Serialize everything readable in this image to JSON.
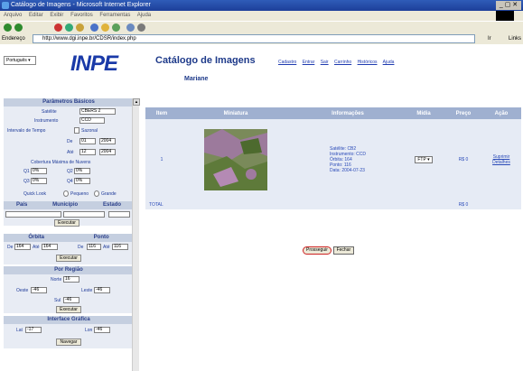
{
  "window": {
    "title": "Catálogo de Imagens - Microsoft Internet Explorer",
    "controls": "_ ▢ ✕"
  },
  "menu": [
    "Arquivo",
    "Editar",
    "Exibir",
    "Favoritos",
    "Ferramentas",
    "Ajuda"
  ],
  "address": {
    "label": "Endereço",
    "url": "http://www.dgi.inpe.br/CDSR/index.php",
    "go": "Ir",
    "links": "Links"
  },
  "colors": {
    "panel_head": "#c5cfe0",
    "table_head": "#9fb0d0",
    "brand": "#1a3aa8"
  },
  "language": {
    "value": "Português"
  },
  "brand": {
    "logo": "INPE"
  },
  "page": {
    "title": "Catálogo de Imagens",
    "user": "Mariane"
  },
  "nav": [
    "Cadastro",
    "Entrar",
    "Sair",
    "Carrinho",
    "Históricos",
    "Ajuda"
  ],
  "search": {
    "basic": {
      "header": "Parâmetros Básicos",
      "satellite_label": "Satélite",
      "satellite_value": "CBERS 2",
      "instrument_label": "Instrumento",
      "instrument_value": "CCD",
      "interval_label": "Intervalo de Tempo",
      "interval_option": "Sazonal",
      "from_label": "De",
      "from_month": "01",
      "from_year": "2004",
      "to_label": "Até",
      "to_month": "12",
      "to_year": "2004",
      "cloud_label": "Cobertura Máxima de Nuvens",
      "q1": "Q1",
      "q2": "Q2",
      "q3": "Q3",
      "q4": "Q4",
      "cloud_value": "0%",
      "quicklook_label": "Quick Look",
      "small_option": "Pequeno",
      "large_option": "Grande"
    },
    "place": {
      "country": "País",
      "city": "Município",
      "state": "Estado",
      "run": "Executar"
    },
    "orbit": {
      "header_orbit": "Órbita",
      "header_point": "Ponto",
      "from": "De",
      "to": "Até",
      "orbit_from": "164",
      "orbit_to": "164",
      "point_from": "116",
      "point_to": "116",
      "run": "Executar"
    },
    "region": {
      "header": "Por Região",
      "north": "Norte",
      "north_value": "16",
      "west": "Oeste",
      "west_value": "-46",
      "east": "Leste",
      "east_value": "-46",
      "south": "Sul",
      "south_value": "-46",
      "run": "Executar"
    },
    "graphic": {
      "header": "Interface Gráfica",
      "lat": "Lat",
      "lat_value": "-17",
      "lon": "Lon",
      "lon_value": "-46",
      "run": "Navegar"
    }
  },
  "table": {
    "headers": [
      "Item",
      "Miniatura",
      "Informações",
      "Mídia",
      "Preço",
      "Ação"
    ],
    "rows": [
      {
        "item": "1",
        "info": {
          "satellite": "Satélite: CB2",
          "instrument": "Instrumento: CCD",
          "orbit": "Órbita: 164",
          "point": "Ponto: 116",
          "date": "Data: 2004-07-23"
        },
        "media": "FTP",
        "price": "R$ 0",
        "actions": [
          "Suprimir",
          "Detalhes"
        ]
      }
    ],
    "total_label": "TOTAL",
    "total_value": "R$ 0"
  },
  "footer": {
    "proceed": "Prosseguir",
    "close": "Fechar"
  }
}
